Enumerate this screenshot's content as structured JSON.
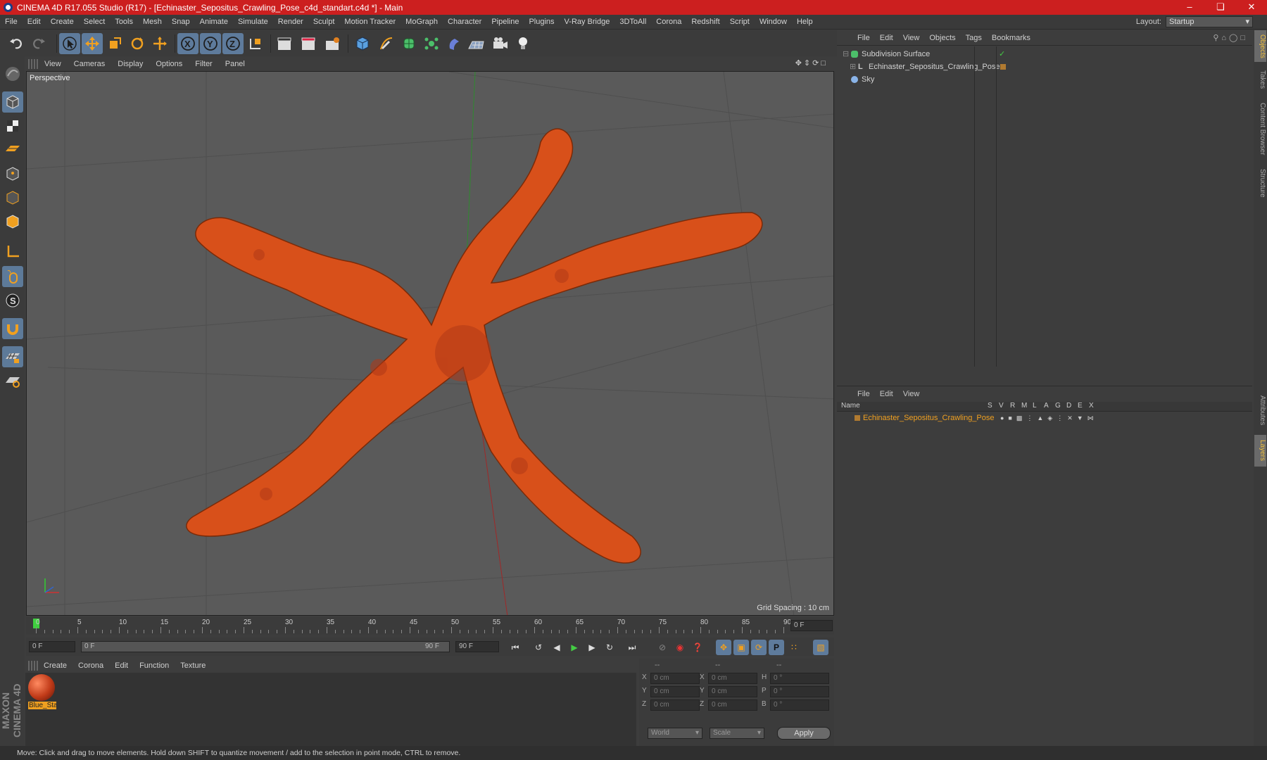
{
  "window": {
    "title": "CINEMA 4D R17.055 Studio (R17) - [Echinaster_Sepositus_Crawling_Pose_c4d_standart.c4d *] - Main"
  },
  "menubar": {
    "items": [
      "File",
      "Edit",
      "Create",
      "Select",
      "Tools",
      "Mesh",
      "Snap",
      "Animate",
      "Simulate",
      "Render",
      "Sculpt",
      "Motion Tracker",
      "MoGraph",
      "Character",
      "Pipeline",
      "Plugins",
      "V-Ray Bridge",
      "3DToAll",
      "Corona",
      "Redshift",
      "Script",
      "Window",
      "Help"
    ],
    "layout_label": "Layout:",
    "layout_value": "Startup"
  },
  "viewport": {
    "menu": [
      "View",
      "Cameras",
      "Display",
      "Options",
      "Filter",
      "Panel"
    ],
    "label": "Perspective",
    "grid_spacing": "Grid Spacing : 10 cm"
  },
  "timeline": {
    "ticks": [
      "0",
      "5",
      "10",
      "15",
      "20",
      "25",
      "30",
      "35",
      "40",
      "45",
      "50",
      "55",
      "60",
      "65",
      "70",
      "75",
      "80",
      "85",
      "90"
    ],
    "current_frame": "0 F",
    "start_field": "0 F",
    "range_start": "0 F",
    "range_end": "90 F",
    "end_field": "90 F"
  },
  "material_manager": {
    "menu": [
      "Create",
      "Corona",
      "Edit",
      "Function",
      "Texture"
    ],
    "materials": [
      {
        "name": "Blue_Sta"
      }
    ]
  },
  "coordinates": {
    "headers": [
      "--",
      "--",
      "--"
    ],
    "rows": [
      {
        "a": "X",
        "av": "0 cm",
        "b": "X",
        "bv": "0 cm",
        "c": "H",
        "cv": "0 °"
      },
      {
        "a": "Y",
        "av": "0 cm",
        "b": "Y",
        "bv": "0 cm",
        "c": "P",
        "cv": "0 °"
      },
      {
        "a": "Z",
        "av": "0 cm",
        "b": "Z",
        "bv": "0 cm",
        "c": "B",
        "cv": "0 °"
      }
    ],
    "mode1": "World",
    "mode2": "Scale",
    "apply": "Apply"
  },
  "object_manager": {
    "menu": [
      "File",
      "Edit",
      "View",
      "Objects",
      "Tags",
      "Bookmarks"
    ],
    "objects": [
      {
        "name": "Subdivision Surface"
      },
      {
        "name": "Echinaster_Sepositus_Crawling_Pose"
      },
      {
        "name": "Sky"
      }
    ]
  },
  "layer_manager": {
    "menu": [
      "File",
      "Edit",
      "View"
    ],
    "columns": [
      "Name",
      "S",
      "V",
      "R",
      "M",
      "L",
      "A",
      "G",
      "D",
      "E",
      "X"
    ],
    "layers": [
      {
        "name": "Echinaster_Sepositus_Crawling_Pose"
      }
    ]
  },
  "right_tabs": [
    "Objects",
    "Takes",
    "Content Browser",
    "Structure",
    "Attributes",
    "Layers"
  ],
  "status": {
    "text": "Move: Click and drag to move elements. Hold down SHIFT to quantize movement / add to the selection in point mode, CTRL to remove."
  },
  "branding": {
    "logo": "MAXON CINEMA 4D"
  },
  "colors": {
    "title_bar": "#cc1f1f",
    "accent_orange": "#f0a020",
    "tool_active": "#5e7b9c",
    "starfish": "#d8501a"
  }
}
